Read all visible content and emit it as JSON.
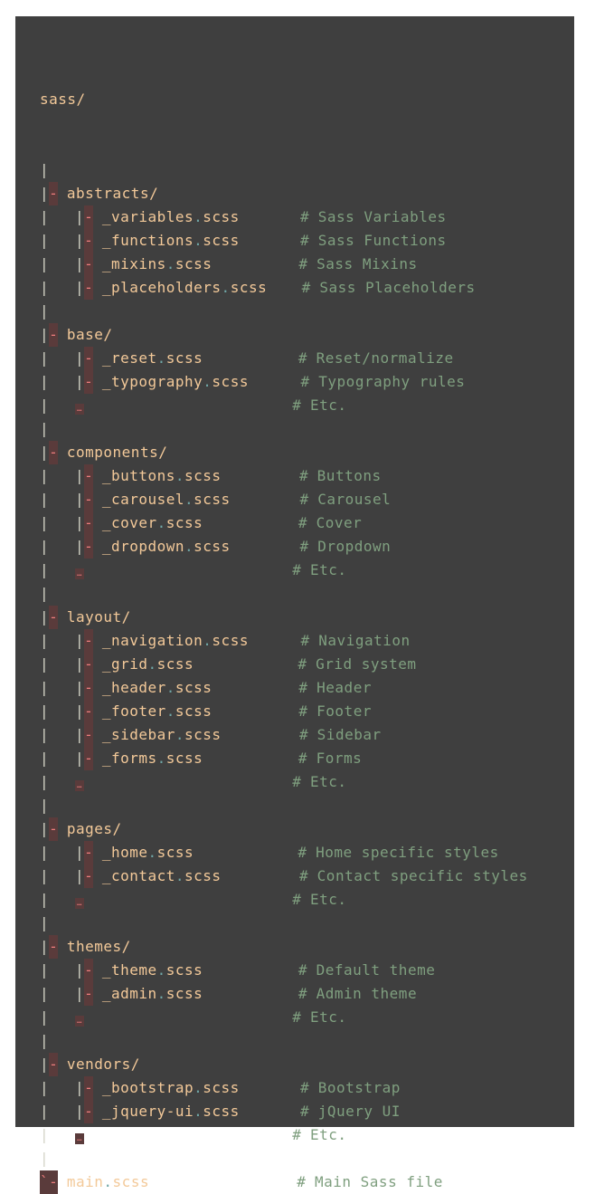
{
  "root": "sass/",
  "pipe": "|",
  "branch_dash": "-",
  "last_tick": "`",
  "comment_marker": "#",
  "ellipsis": "…",
  "colors": {
    "background": "#3f3f3f",
    "tree": "#d5d5c8",
    "name": "#f3c999",
    "dot": "#6fa6a6",
    "comment": "#7f9f7f",
    "error_bg": "#5a3b3b",
    "error_fg": "#ec7c7c"
  },
  "folders": [
    {
      "name": "abstracts/",
      "files": [
        {
          "base": "_variables",
          "ext": "scss",
          "comment": "Sass Variables"
        },
        {
          "base": "_functions",
          "ext": "scss",
          "comment": "Sass Functions"
        },
        {
          "base": "_mixins",
          "ext": "scss",
          "comment": "Sass Mixins"
        },
        {
          "base": "_placeholders",
          "ext": "scss",
          "comment": "Sass Placeholders"
        }
      ],
      "etc": null
    },
    {
      "name": "base/",
      "files": [
        {
          "base": "_reset",
          "ext": "scss",
          "comment": "Reset/normalize"
        },
        {
          "base": "_typography",
          "ext": "scss",
          "comment": "Typography rules"
        }
      ],
      "etc": "Etc."
    },
    {
      "name": "components/",
      "files": [
        {
          "base": "_buttons",
          "ext": "scss",
          "comment": "Buttons"
        },
        {
          "base": "_carousel",
          "ext": "scss",
          "comment": "Carousel"
        },
        {
          "base": "_cover",
          "ext": "scss",
          "comment": "Cover"
        },
        {
          "base": "_dropdown",
          "ext": "scss",
          "comment": "Dropdown"
        }
      ],
      "etc": "Etc."
    },
    {
      "name": "layout/",
      "files": [
        {
          "base": "_navigation",
          "ext": "scss",
          "comment": "Navigation"
        },
        {
          "base": "_grid",
          "ext": "scss",
          "comment": "Grid system"
        },
        {
          "base": "_header",
          "ext": "scss",
          "comment": "Header"
        },
        {
          "base": "_footer",
          "ext": "scss",
          "comment": "Footer"
        },
        {
          "base": "_sidebar",
          "ext": "scss",
          "comment": "Sidebar"
        },
        {
          "base": "_forms",
          "ext": "scss",
          "comment": "Forms"
        }
      ],
      "etc": "Etc."
    },
    {
      "name": "pages/",
      "files": [
        {
          "base": "_home",
          "ext": "scss",
          "comment": "Home specific styles"
        },
        {
          "base": "_contact",
          "ext": "scss",
          "comment": "Contact specific styles"
        }
      ],
      "etc": "Etc."
    },
    {
      "name": "themes/",
      "files": [
        {
          "base": "_theme",
          "ext": "scss",
          "comment": "Default theme"
        },
        {
          "base": "_admin",
          "ext": "scss",
          "comment": "Admin theme"
        }
      ],
      "etc": "Etc."
    },
    {
      "name": "vendors/",
      "files": [
        {
          "base": "_bootstrap",
          "ext": "scss",
          "comment": "Bootstrap"
        },
        {
          "base": "_jquery-ui",
          "ext": "scss",
          "comment": "jQuery UI"
        }
      ],
      "etc": "Etc."
    }
  ],
  "main_file": {
    "base": "main",
    "ext": "scss",
    "comment": "Main Sass file"
  }
}
